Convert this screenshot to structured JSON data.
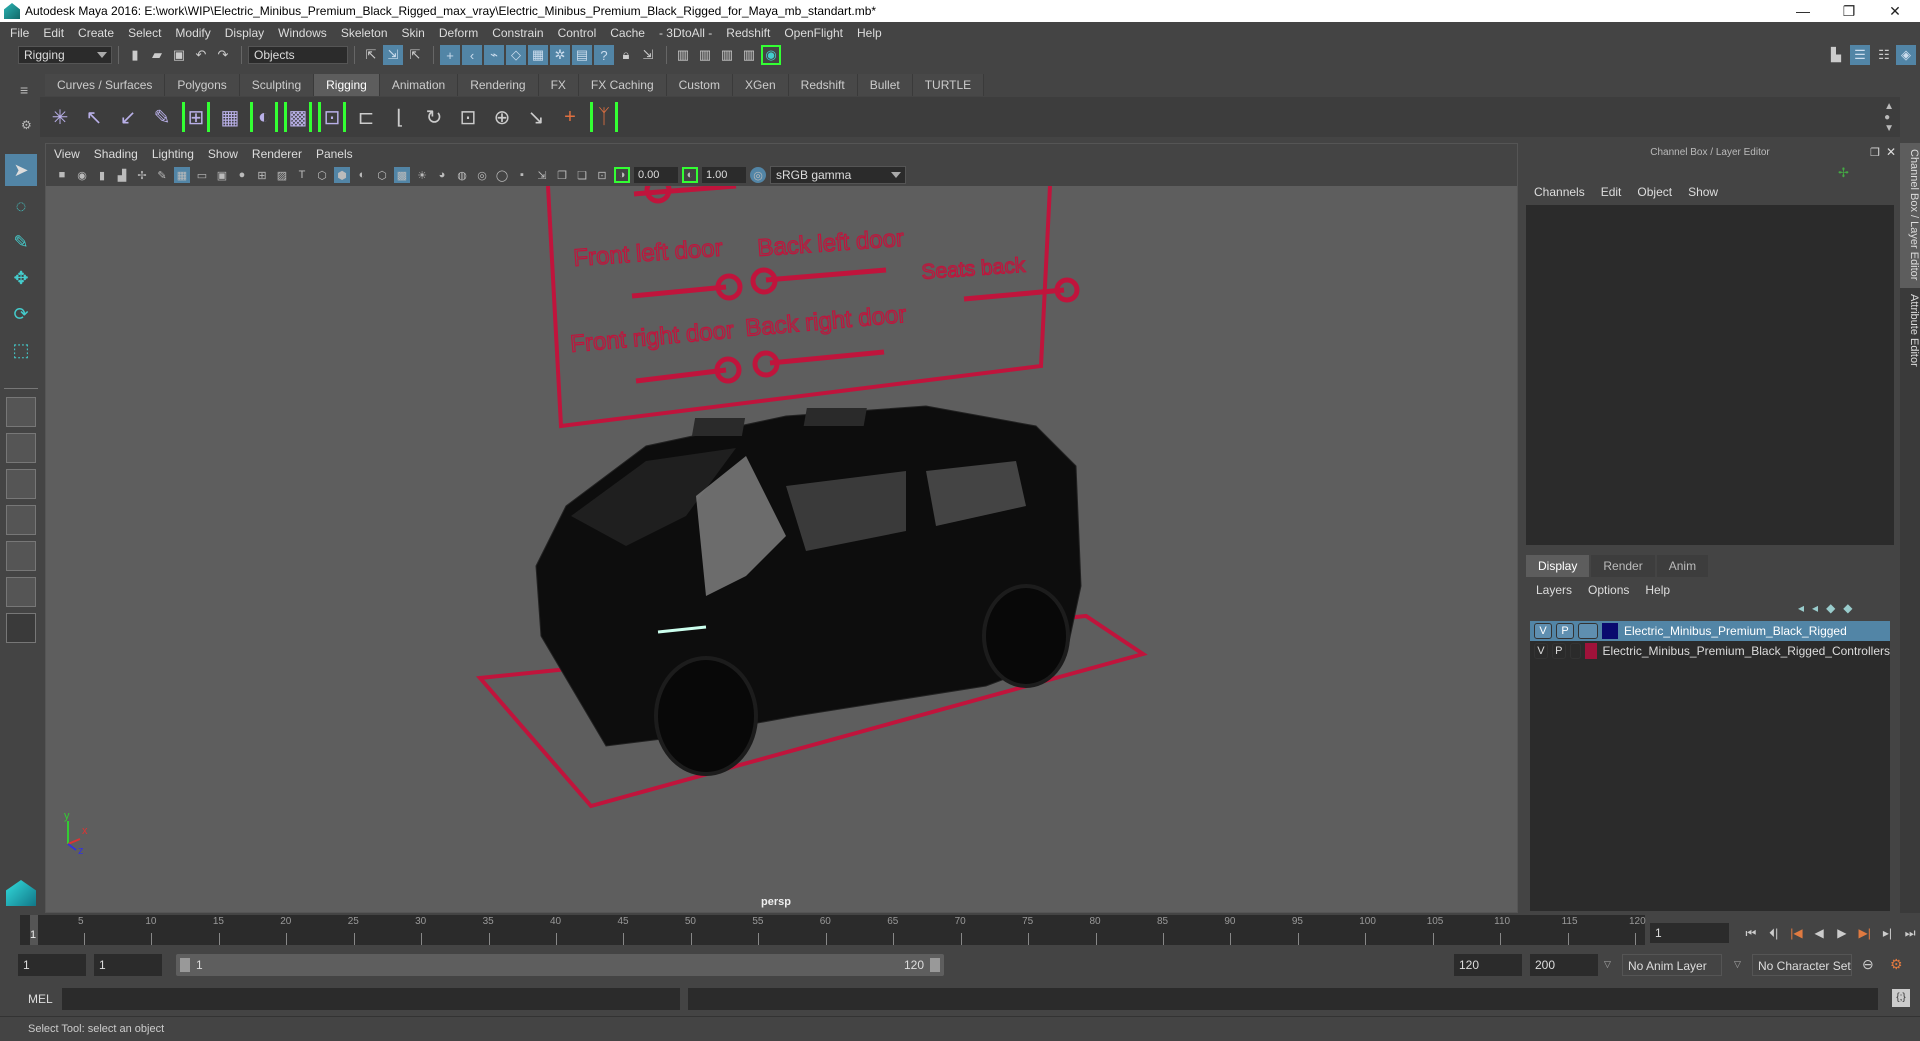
{
  "title": "Autodesk Maya 2016: E:\\work\\WIP\\Electric_Minibus_Premium_Black_Rigged_max_vray\\Electric_Minibus_Premium_Black_Rigged_for_Maya_mb_standart.mb*",
  "window_controls": {
    "minimize": "—",
    "maximize": "❐",
    "close": "✕"
  },
  "menu": [
    "File",
    "Edit",
    "Create",
    "Select",
    "Modify",
    "Display",
    "Windows",
    "Skeleton",
    "Skin",
    "Deform",
    "Constrain",
    "Control",
    "Cache",
    "- 3DtoAll -",
    "Redshift",
    "OpenFlight",
    "Help"
  ],
  "status_line": {
    "mode": "Rigging",
    "selection_field": "Objects"
  },
  "shelf_tabs": [
    "Curves / Surfaces",
    "Polygons",
    "Sculpting",
    "Rigging",
    "Animation",
    "Rendering",
    "FX",
    "FX Caching",
    "Custom",
    "XGen",
    "Redshift",
    "Bullet",
    "TURTLE"
  ],
  "shelf_active": "Rigging",
  "shelf_icons": [
    "joint-tool",
    "ik-handle",
    "ik-spline",
    "paint-weights",
    "bind-skin",
    "skin-cluster",
    "smooth-bind",
    "lattice",
    "cluster",
    "parent-constraint",
    "point-constraint",
    "orient-constraint",
    "scale-constraint",
    "aim-constraint",
    "pole-vector",
    "locator",
    "controller"
  ],
  "tools": [
    "select-tool",
    "lasso-tool",
    "paint-select-tool",
    "move-tool",
    "rotate-tool",
    "scale-tool"
  ],
  "viewport": {
    "menu": [
      "View",
      "Shading",
      "Lighting",
      "Show",
      "Renderer",
      "Panels"
    ],
    "exposure": "0.00",
    "gamma": "1.00",
    "color_space": "sRGB gamma",
    "camera_label": "persp",
    "controller_labels": [
      "Front left door",
      "Back left door",
      "Seats back",
      "Front right door",
      "Back right door"
    ],
    "axis": {
      "y": "y",
      "x": "x",
      "z": "z"
    }
  },
  "right_panel": {
    "header": "Channel Box / Layer Editor",
    "menu": [
      "Channels",
      "Edit",
      "Object",
      "Show"
    ],
    "layer_tabs": [
      "Display",
      "Render",
      "Anim"
    ],
    "layer_tab_active": "Display",
    "layer_menu": [
      "Layers",
      "Options",
      "Help"
    ],
    "layers": [
      {
        "v": "V",
        "p": "P",
        "name": "Electric_Minibus_Premium_Black_Rigged",
        "color": "#0a0a6e",
        "selected": true
      },
      {
        "v": "V",
        "p": "P",
        "name": "Electric_Minibus_Premium_Black_Rigged_Controllers",
        "color": "#a0123a",
        "selected": false
      }
    ]
  },
  "side_tabs": [
    "Channel Box / Layer Editor",
    "Attribute Editor"
  ],
  "timeline": {
    "ticks": [
      5,
      10,
      15,
      20,
      25,
      30,
      35,
      40,
      45,
      50,
      55,
      60,
      65,
      70,
      75,
      80,
      85,
      90,
      95,
      100,
      105,
      110,
      115,
      120
    ],
    "start": 1,
    "end": 120,
    "current_frame": "1"
  },
  "range": {
    "start_field": "1",
    "anim_start_field": "1",
    "slider_start": "1",
    "slider_end": "120",
    "end_field": "120",
    "anim_end_field": "200",
    "anim_layer": "No Anim Layer",
    "character_set": "No Character Set"
  },
  "mel_label": "MEL",
  "help_line": "Select Tool: select an object",
  "colors": {
    "accent": "#5285a6",
    "controller": "#c0143c",
    "shelf_bracket": "#33ff33"
  }
}
